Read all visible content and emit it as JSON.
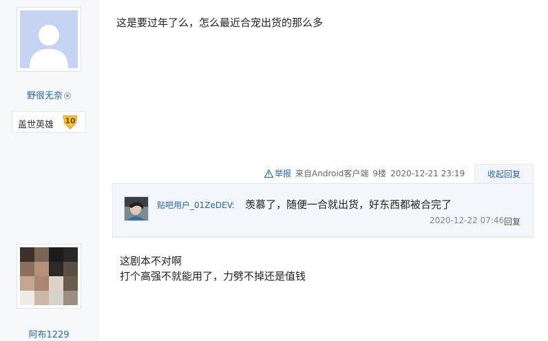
{
  "post1": {
    "username": "野很无奈",
    "badge_title": "盖世英雄",
    "badge_level": "10",
    "content": "这是要过年了么，怎么最近合宠出货的那么多",
    "tail": {
      "report": "举报",
      "source": "来自Android客户端",
      "floor": "9楼",
      "time": "2020-12-21 23:19"
    },
    "collapse_label": "收起回复"
  },
  "reply": {
    "username": "贴吧用户_01ZeDEV:",
    "content": "羡慕了，随便一合就出货，好东西都被合完了",
    "time": "2020-12-22 07:46",
    "reply_label": "回复"
  },
  "post2": {
    "username": "阿布1229",
    "content_line1": "这剧本不对啊",
    "content_line2": "打个高强不就能用了，力劈不掉还是值钱"
  },
  "colors": {
    "link": "#2d64b3",
    "sidebar_bg": "#f6f8fc",
    "reply_bg": "#f3f6fb"
  }
}
